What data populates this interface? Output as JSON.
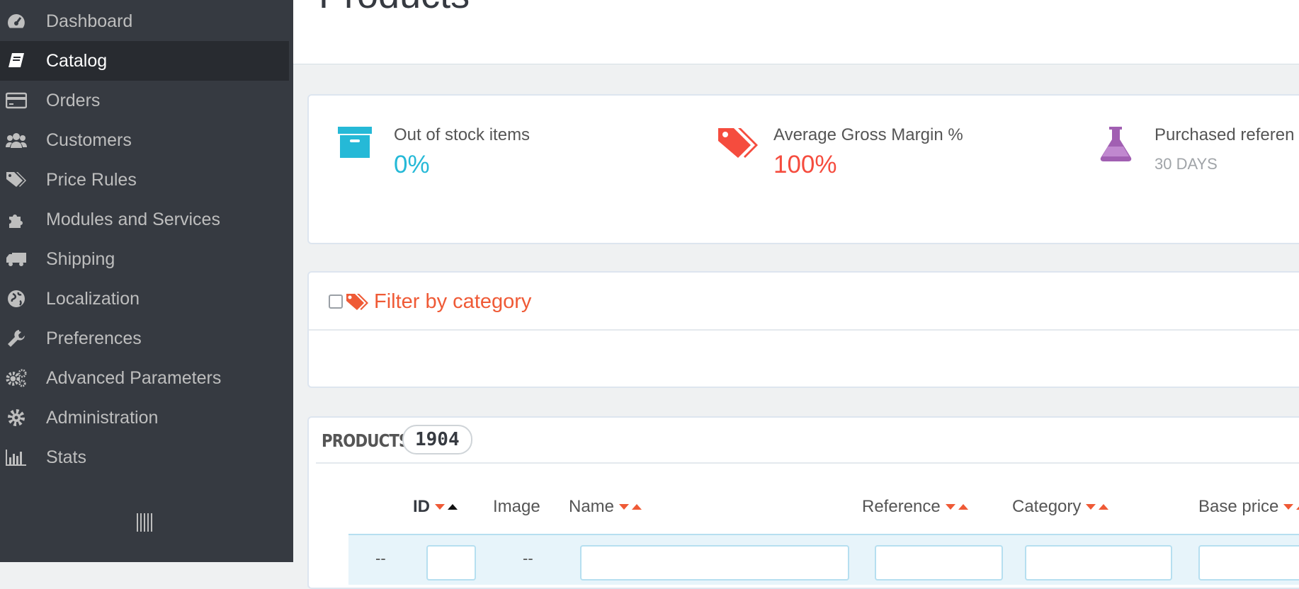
{
  "sidebar": {
    "items": [
      {
        "label": "Dashboard",
        "icon": "dashboard-gauge-icon"
      },
      {
        "label": "Catalog",
        "icon": "book-icon",
        "active": true
      },
      {
        "label": "Orders",
        "icon": "credit-card-icon"
      },
      {
        "label": "Customers",
        "icon": "users-icon"
      },
      {
        "label": "Price Rules",
        "icon": "tags-icon"
      },
      {
        "label": "Modules and Services",
        "icon": "puzzle-icon"
      },
      {
        "label": "Shipping",
        "icon": "truck-icon"
      },
      {
        "label": "Localization",
        "icon": "globe-icon"
      },
      {
        "label": "Preferences",
        "icon": "wrench-icon"
      },
      {
        "label": "Advanced Parameters",
        "icon": "cogs-icon"
      },
      {
        "label": "Administration",
        "icon": "cog-icon"
      },
      {
        "label": "Stats",
        "icon": "bar-chart-icon"
      }
    ]
  },
  "header": {
    "title": "Products"
  },
  "kpis": [
    {
      "label": "Out of stock items",
      "value": "0%",
      "icon": "archive-box-icon",
      "color": "#25b9d7"
    },
    {
      "label": "Average Gross Margin %",
      "value": "100%",
      "icon": "price-tag-icon",
      "color": "#f54c3e"
    },
    {
      "label": "Purchased referen",
      "sub": "30 DAYS",
      "icon": "flask-icon",
      "color": "#a15fb2"
    }
  ],
  "filter": {
    "label": "Filter by category",
    "checked": false
  },
  "products": {
    "title": "PRODUCTS",
    "count": "1904",
    "columns": [
      "ID",
      "Image",
      "Name",
      "Reference",
      "Category",
      "Base price"
    ],
    "filter_placeholders": {
      "bulk": "--",
      "image": "--"
    }
  },
  "colors": {
    "accent": "#ef5a36",
    "sidebar_bg": "#363a41",
    "active_bg": "#282b30"
  }
}
